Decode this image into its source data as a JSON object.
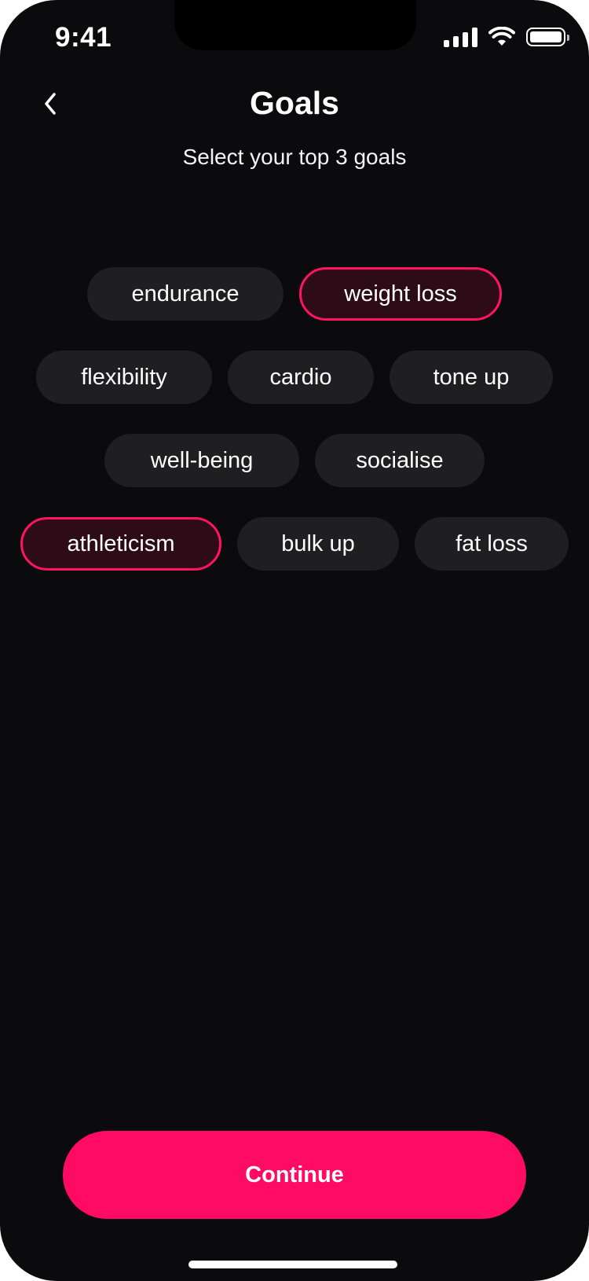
{
  "status_bar": {
    "time": "9:41",
    "icons": [
      "cellular-signal-icon",
      "wifi-icon",
      "battery-icon"
    ]
  },
  "header": {
    "back_icon": "chevron-left-icon",
    "title": "Goals",
    "subtitle": "Select your top 3 goals"
  },
  "goals": [
    {
      "label": "endurance",
      "selected": false
    },
    {
      "label": "weight loss",
      "selected": true
    },
    {
      "label": "flexibility",
      "selected": false
    },
    {
      "label": "cardio",
      "selected": false
    },
    {
      "label": "tone up",
      "selected": false
    },
    {
      "label": "well-being",
      "selected": false
    },
    {
      "label": "socialise",
      "selected": false
    },
    {
      "label": "athleticism",
      "selected": true
    },
    {
      "label": "bulk up",
      "selected": false
    },
    {
      "label": "fat loss",
      "selected": false
    }
  ],
  "footer": {
    "continue_label": "Continue"
  },
  "colors": {
    "background": "#0b0b0d",
    "chip": "#1f1f21",
    "chip_selected_fill": "#2d0c17",
    "accent": "#ff0b63"
  }
}
